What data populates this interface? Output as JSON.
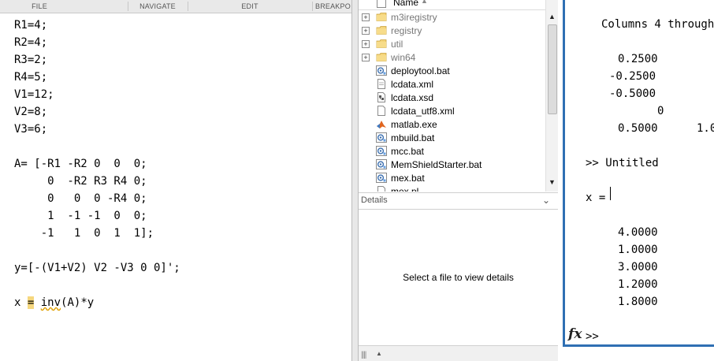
{
  "editor": {
    "tabs": [
      "FILE",
      "NAVIGATE",
      "EDIT",
      "BREAKPO"
    ],
    "code_lines": [
      "R1=4;",
      "R2=4;",
      "R3=2;",
      "R4=5;",
      "V1=12;",
      "V2=8;",
      "V3=6;",
      "",
      "A= [-R1 -R2 0  0  0;",
      "     0  -R2 R3 R4 0;",
      "     0   0  0 -R4 0;",
      "     1  -1 -1  0  0;",
      "    -1   1  0  1  1];",
      "",
      "y=[-(V1+V2) V2 -V3 0 0]';",
      ""
    ],
    "last_line": {
      "var": "x",
      "space1": " ",
      "eq": "=",
      "space2": " ",
      "func": "inv",
      "rest": "(A)*y"
    }
  },
  "folder": {
    "header_label": "Name",
    "items": [
      {
        "name": "m3iregistry",
        "type": "folder",
        "icon": "folder-icon"
      },
      {
        "name": "registry",
        "type": "folder",
        "icon": "folder-icon"
      },
      {
        "name": "util",
        "type": "folder",
        "icon": "folder-icon"
      },
      {
        "name": "win64",
        "type": "folder",
        "icon": "folder-icon"
      },
      {
        "name": "deploytool.bat",
        "type": "file",
        "icon": "batch-file-icon"
      },
      {
        "name": "lcdata.xml",
        "type": "file",
        "icon": "xml-file-icon"
      },
      {
        "name": "lcdata.xsd",
        "type": "file",
        "icon": "xsd-file-icon"
      },
      {
        "name": "lcdata_utf8.xml",
        "type": "file",
        "icon": "xml-file-icon"
      },
      {
        "name": "matlab.exe",
        "type": "file",
        "icon": "matlab-logo-icon"
      },
      {
        "name": "mbuild.bat",
        "type": "file",
        "icon": "batch-file-icon"
      },
      {
        "name": "mcc.bat",
        "type": "file",
        "icon": "batch-file-icon"
      },
      {
        "name": "MemShieldStarter.bat",
        "type": "file",
        "icon": "batch-file-icon"
      },
      {
        "name": "mex.bat",
        "type": "file",
        "icon": "batch-file-icon"
      },
      {
        "name": "mex.pl",
        "type": "file",
        "icon": "file-icon"
      }
    ],
    "details_title": "Details",
    "details_message": "Select a file to view details"
  },
  "command_window": {
    "columns_text": "Columns 4 through",
    "values_col1": [
      "0.2500",
      "-0.2500",
      "-0.5000",
      "0",
      "0.5000"
    ],
    "values_col2_partial": "1.0",
    "prompt_text": ">> Untitled",
    "result_var": "x =",
    "x_values": [
      "4.0000",
      "1.0000",
      "3.0000",
      "1.2000",
      "1.8000"
    ],
    "fx_label": "fx",
    "bottom_prompt": ">>",
    "accent_color": "#2f6fb3"
  }
}
